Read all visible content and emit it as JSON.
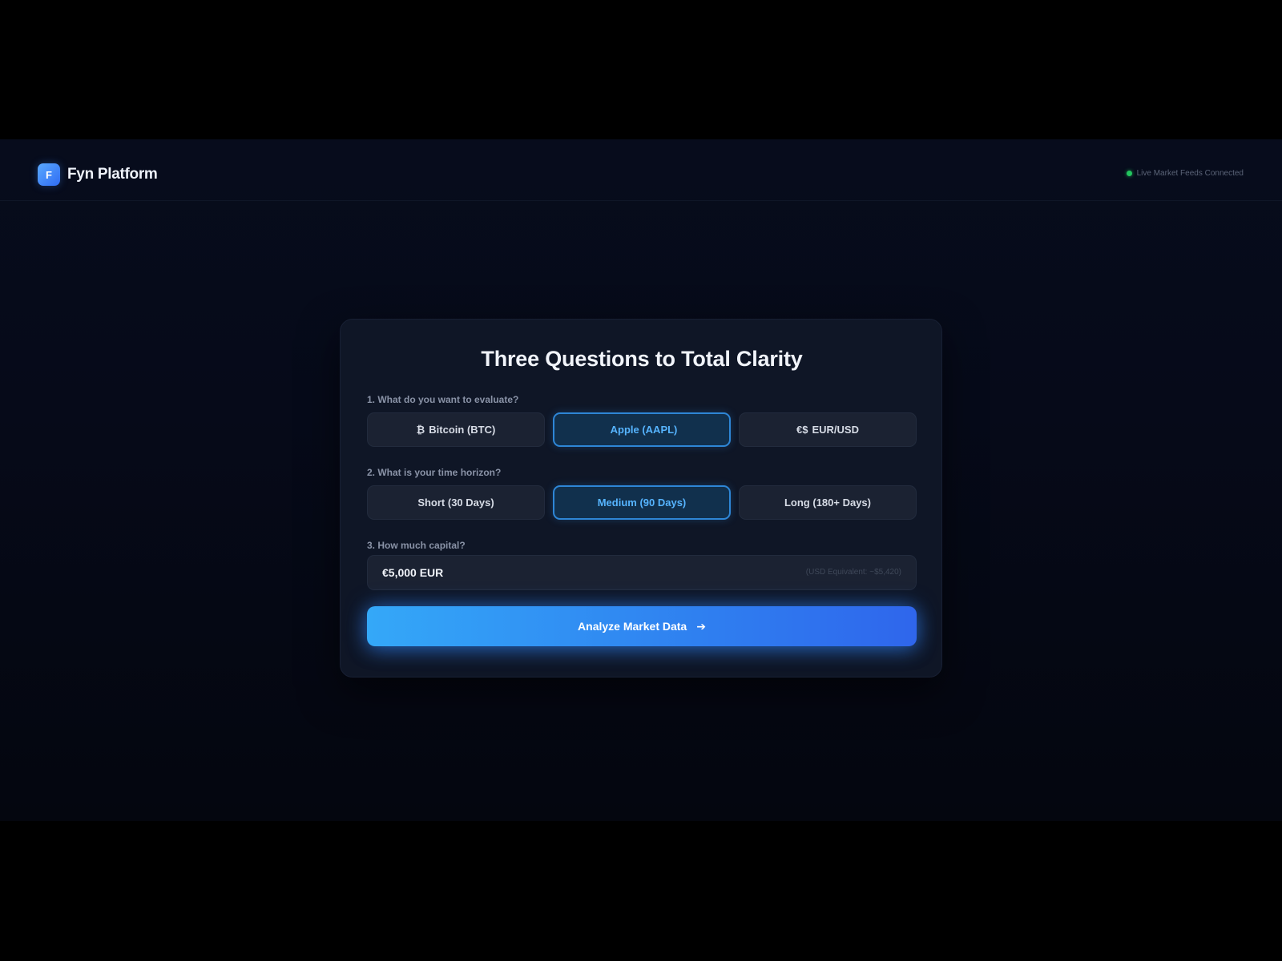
{
  "header": {
    "logo_letter": "F",
    "brand_name": "Fyn Platform",
    "status_text": "Live Market Feeds Connected",
    "status_color": "#22c55e"
  },
  "card": {
    "title": "Three Questions to Total Clarity",
    "question1": {
      "label": "1. What do you want to evaluate?",
      "options": [
        {
          "glyph": "₿",
          "label": "Bitcoin (BTC)",
          "selected": false
        },
        {
          "glyph": "",
          "label": "Apple (AAPL)",
          "selected": true
        },
        {
          "glyph": "€$",
          "label": "EUR/USD",
          "selected": false
        }
      ]
    },
    "question2": {
      "label": "2. What is your time horizon?",
      "options": [
        {
          "label": "Short (30 Days)",
          "selected": false
        },
        {
          "label": "Medium (90 Days)",
          "selected": true
        },
        {
          "label": "Long (180+ Days)",
          "selected": false
        }
      ]
    },
    "question3": {
      "label": "3. How much capital?",
      "value": "€5,000 EUR",
      "equivalent": "(USD Equivalent: ~$5,420)"
    },
    "cta": {
      "label": "Analyze Market Data",
      "icon": "arrow-right-icon"
    }
  },
  "colors": {
    "accent": "#2f80f0",
    "selected_text": "#56b4ff",
    "background": "#060a19"
  }
}
